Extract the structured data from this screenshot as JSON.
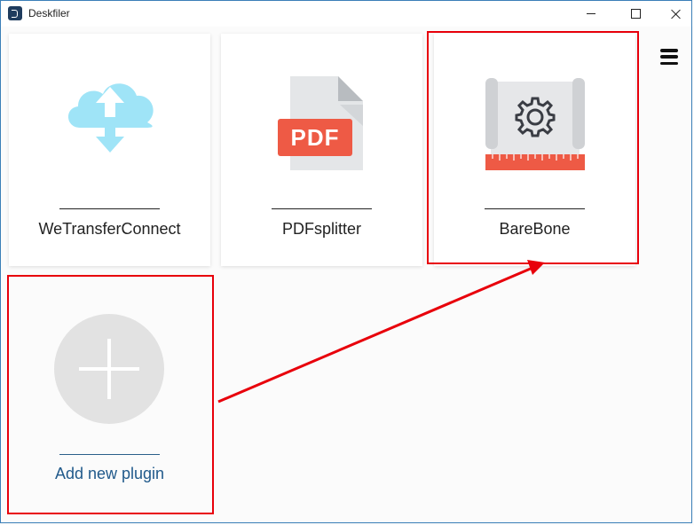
{
  "window": {
    "title": "Deskfiler"
  },
  "plugins": [
    {
      "label": "WeTransferConnect",
      "icon": "cloud-transfer-icon"
    },
    {
      "label": "PDFsplitter",
      "icon": "pdf-file-icon",
      "icon_text": "PDF"
    },
    {
      "label": "BareBone",
      "icon": "blueprint-gear-icon"
    }
  ],
  "add_plugin": {
    "label": "Add new plugin",
    "icon": "plus-icon"
  },
  "colors": {
    "cloud": "#9fe4f7",
    "pdf_badge": "#ee5a45",
    "ruler": "#ee5a45",
    "link": "#215a8b",
    "highlight": "#e8000b"
  }
}
